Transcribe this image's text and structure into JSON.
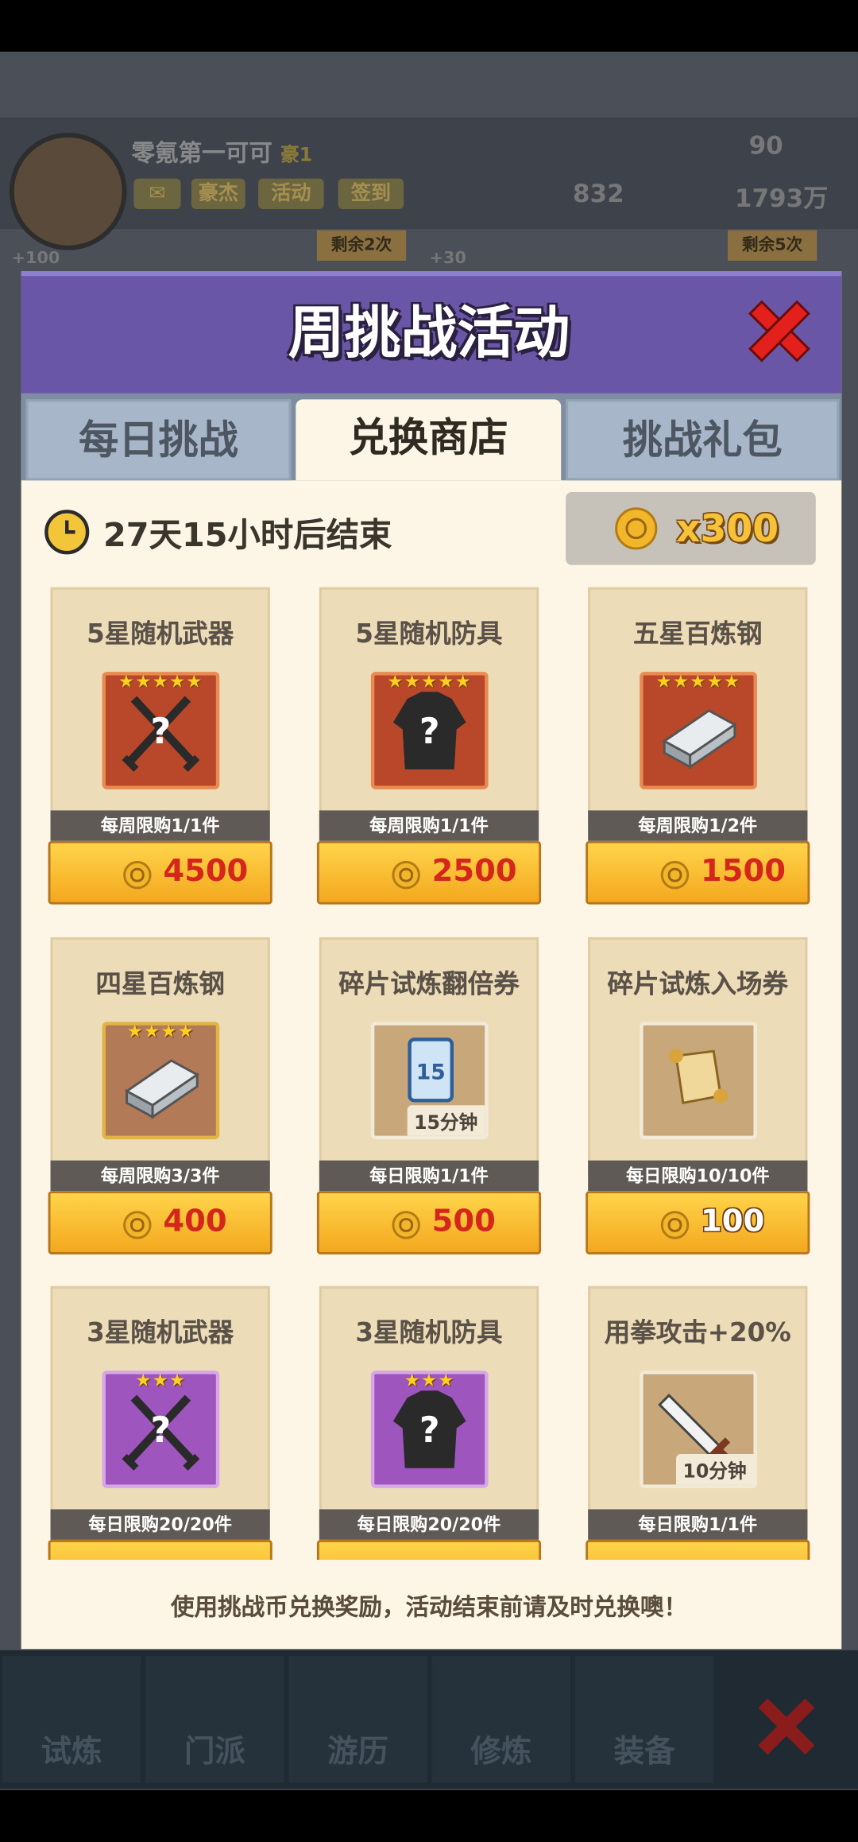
{
  "background": {
    "player_name": "零氪第一可可",
    "player_title": "豪1",
    "buttons": [
      "豪杰",
      "活动",
      "签到"
    ],
    "gems": "90",
    "tokens": "832",
    "gold": "1793万",
    "remaining_left": "剩余2次",
    "remaining_right": "剩余5次",
    "bonus_left": "+100",
    "bonus_mid": "+30",
    "nav": [
      "试炼",
      "门派",
      "游历",
      "修炼",
      "装备"
    ]
  },
  "modal": {
    "title": "周挑战活动",
    "tabs": [
      "每日挑战",
      "兑换商店",
      "挑战礼包"
    ],
    "active_tab": 1,
    "timer": "27天15小时后结束",
    "coin_balance": "x300",
    "footer": "使用挑战币兑换奖励，活动结束前请及时兑换噢！"
  },
  "items": [
    {
      "name": "5星随机武器",
      "stars": "★★★★★",
      "icon": "crossed-swords-question-icon",
      "frame": "red",
      "limit": "每周限购1/1件",
      "price": "4500",
      "price_style": "red"
    },
    {
      "name": "5星随机防具",
      "stars": "★★★★★",
      "icon": "armor-question-icon",
      "frame": "red",
      "limit": "每周限购1/1件",
      "price": "2500",
      "price_style": "red"
    },
    {
      "name": "五星百炼钢",
      "stars": "★★★★★",
      "icon": "steel-ingot-icon",
      "frame": "red",
      "limit": "每周限购1/2件",
      "price": "1500",
      "price_style": "red"
    },
    {
      "name": "四星百炼钢",
      "stars": "★★★★",
      "icon": "steel-ingot-icon",
      "frame": "brown",
      "limit": "每周限购3/3件",
      "price": "400",
      "price_style": "red"
    },
    {
      "name": "碎片试炼翻倍券",
      "stars": "",
      "icon": "double-ticket-icon",
      "frame": "tan",
      "duration": "15分钟",
      "limit": "每日限购1/1件",
      "price": "500",
      "price_style": "red"
    },
    {
      "name": "碎片试炼入场券",
      "stars": "",
      "icon": "scroll-ticket-icon",
      "frame": "tan",
      "limit": "每日限购10/10件",
      "price": "100",
      "price_style": "white"
    },
    {
      "name": "3星随机武器",
      "stars": "★★★",
      "icon": "crossed-swords-question-icon",
      "frame": "purple",
      "limit": "每日限购20/20件",
      "price": "",
      "price_style": "red"
    },
    {
      "name": "3星随机防具",
      "stars": "★★★",
      "icon": "armor-question-icon",
      "frame": "purple",
      "limit": "每日限购20/20件",
      "price": "",
      "price_style": "red"
    },
    {
      "name": "用拳攻击+20%",
      "stars": "",
      "icon": "sword-buff-icon",
      "frame": "tan",
      "duration": "10分钟",
      "limit": "每日限购1/1件",
      "price": "",
      "price_style": "red"
    }
  ]
}
